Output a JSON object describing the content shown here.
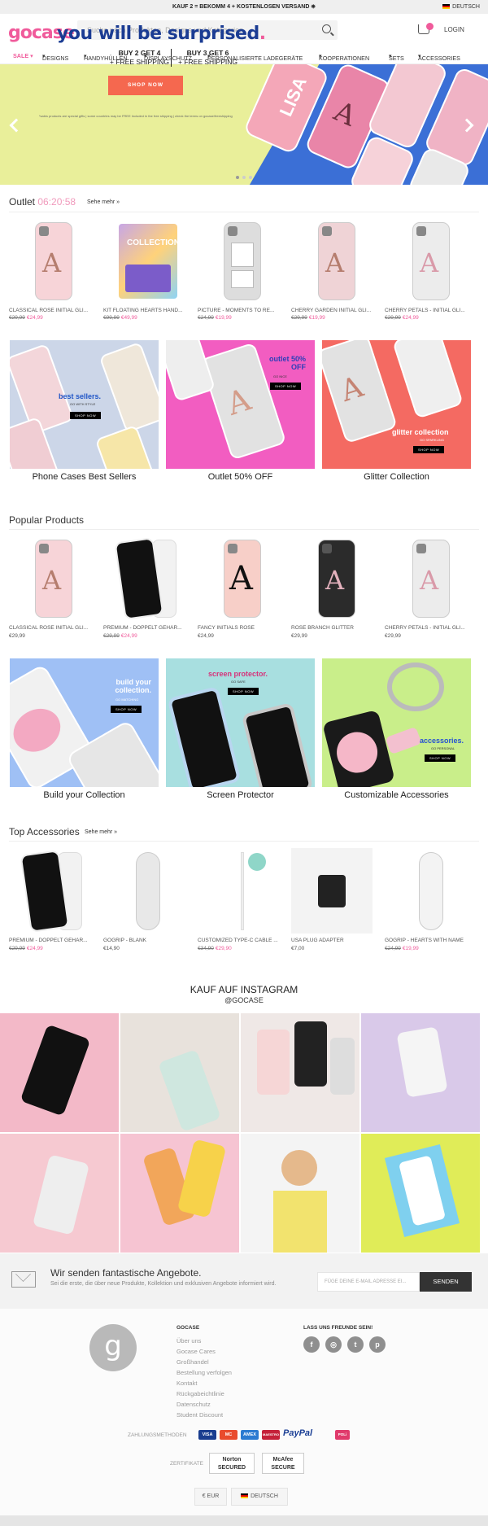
{
  "topbar": {
    "promo": "KAUF 2 = BEKOMM 4 + KOSTENLOSEN VERSAND",
    "language": "DEUTSCH"
  },
  "header": {
    "logo": "gocase",
    "search_placeholder": "Suche nach Produkten, Designs und Kategorien",
    "login": "LOGIN",
    "cart_icon": "cart-icon"
  },
  "nav": [
    "SALE",
    "DESIGNS",
    "HANDYHÜLLEN",
    "DISPLAYSCHUTZ",
    "PERSONALISIERTE LADEGERÄTE",
    "KOOPERATIONEN",
    "SETS",
    "ACCESSORIES"
  ],
  "hero": {
    "title_main": "you will be surprised",
    "title_dot": ".",
    "offer1_title": "BUY 2 GET 4",
    "offer1_sub": "+ FREE SHIPPING",
    "offer2_title": "BUY 3 GET 6",
    "offer2_sub": "+ FREE SHIPPING",
    "cta": "SHOP NOW",
    "note": "*sales products are special gifts | some countries may be FREE Included in the free shipping | check the terms on gocase/freeshipping",
    "case_text": "LISA"
  },
  "outlet": {
    "title": "Outlet",
    "timer": "06:20:58",
    "more": "Sehe mehr »",
    "products": [
      {
        "name": "CLASSICAL ROSE INITIAL GLI...",
        "old": "€29,99",
        "price": "€24,99"
      },
      {
        "name": "KIT FLOATING HEARTS HAND...",
        "old": "€99,99",
        "price": "€49,99"
      },
      {
        "name": "PICTURE - MOMENTS TO RE...",
        "old": "€24,99",
        "price": "€19,99"
      },
      {
        "name": "CHERRY GARDEN INITIAL GLI...",
        "old": "€29,99",
        "price": "€19,99"
      },
      {
        "name": "CHERRY PETALS - INITIAL GLI...",
        "old": "€29,99",
        "price": "€24,99"
      }
    ]
  },
  "banners1": [
    {
      "caption": "Phone Cases Best Sellers",
      "label": "best sellers.",
      "sub": "GO WITH STYLE",
      "btn": "SHOP NOW"
    },
    {
      "caption": "Outlet 50% OFF",
      "label": "outlet 50% OFF",
      "sub": "GO NICE",
      "btn": "SHOP NOW"
    },
    {
      "caption": "Glitter Collection",
      "label": "glitter collection",
      "sub": "GO SPARKLING",
      "btn": "SHOP NOW"
    }
  ],
  "popular": {
    "title": "Popular Products",
    "products": [
      {
        "name": "CLASSICAL ROSE INITIAL GLI...",
        "old": "",
        "price": "€29,99"
      },
      {
        "name": "PREMIUM - DOPPELT GEHÄR...",
        "old": "€29,99",
        "price": "€24,99"
      },
      {
        "name": "FANCY INITIALS ROSE",
        "old": "",
        "price": "€24,99"
      },
      {
        "name": "ROSE BRANCH GLITTER",
        "old": "",
        "price": "€29,99"
      },
      {
        "name": "CHERRY PETALS - INITIAL GLI...",
        "old": "",
        "price": "€29,99"
      }
    ]
  },
  "banners2": [
    {
      "caption": "Build your Collection",
      "label": "build your collection.",
      "sub": "GO MATCHING",
      "btn": "SHOP NOW"
    },
    {
      "caption": "Screen Protector",
      "label": "screen protector.",
      "sub": "GO SAFE",
      "btn": "SHOP NOW"
    },
    {
      "caption": "Customizable Accessories",
      "label": "accessories.",
      "sub": "GO PERSONAL",
      "btn": "SHOP NOW"
    }
  ],
  "accessories": {
    "title": "Top Accessories",
    "more": "Sehe mehr »",
    "products": [
      {
        "name": "PREMIUM - DOPPELT GEHÄR...",
        "old": "€29,99",
        "price": "€24,99"
      },
      {
        "name": "GOGRIP - BLANK",
        "old": "",
        "price": "€14,90"
      },
      {
        "name": "CUSTOMIZED TYPE-C CABLE ...",
        "old": "€34,90",
        "price": "€29,90"
      },
      {
        "name": "USA PLUG ADAPTER",
        "old": "",
        "price": "€7,00"
      },
      {
        "name": "GOGRIP - HEARTS WITH NAME",
        "old": "€24,99",
        "price": "€19,99"
      }
    ]
  },
  "instagram": {
    "title": "KAUF AUF INSTAGRAM",
    "handle": "@GOCASE"
  },
  "newsletter": {
    "title": "Wir senden fantastische Angebote.",
    "subtitle": "Sei die erste, die über neue Produkte, Kollektion und exklusiven Angebote informiert wird.",
    "placeholder": "FÜGE DEINE E-MAIL ADRESSE EI...",
    "button": "SENDEN"
  },
  "footer": {
    "logo_letter": "g",
    "col_title": "GOCASE",
    "links": [
      "Über uns",
      "Gocase Cares",
      "Großhandel",
      "Bestellung verfolgen",
      "Kontakt",
      "Rückgabeichtlinie",
      "Datenschutz",
      "Student Discount"
    ],
    "social_title": "LASS UNS FREUNDE SEIN!",
    "social": [
      "f",
      "◎",
      "t",
      "p"
    ],
    "payment_label": "ZAHLUNGSMETHODEN",
    "payments": [
      "VISA",
      "MC",
      "AMEX",
      "MAESTRO",
      "PayPal",
      "POLi"
    ],
    "cert_label": "ZERTIFIKATE",
    "cert1": "Norton SECURED",
    "cert2": "McAfee SECURE",
    "currency": "€ EUR",
    "language": "DEUTSCH"
  }
}
